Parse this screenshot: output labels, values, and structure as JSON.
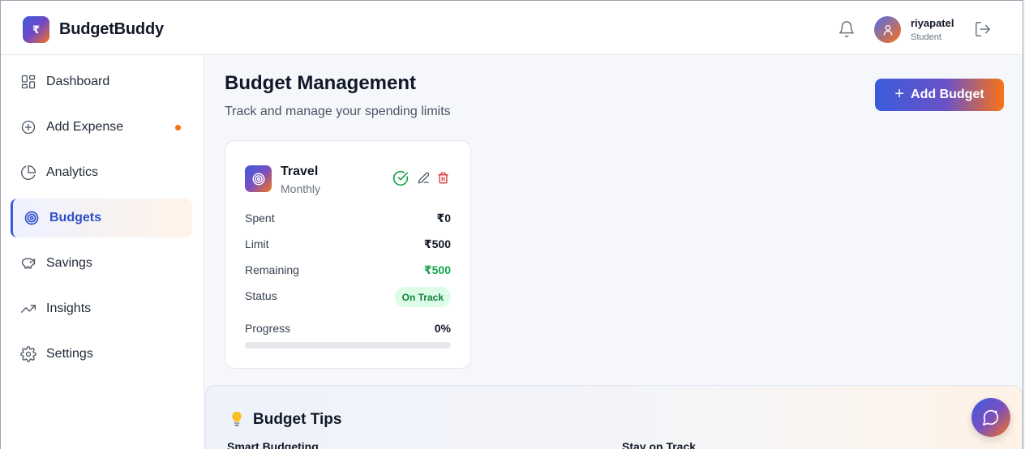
{
  "app": {
    "logo_symbol": "₹",
    "name": "BudgetBuddy"
  },
  "header": {
    "user_name": "riyapatel",
    "user_role": "Student",
    "icons": [
      "bell-icon",
      "user-icon",
      "logout-icon"
    ]
  },
  "sidebar": {
    "items": [
      {
        "label": "Dashboard",
        "icon": "dashboard-grid-icon",
        "active": false,
        "has_dot": false
      },
      {
        "label": "Add Expense",
        "icon": "plus-circle-icon",
        "active": false,
        "has_dot": true
      },
      {
        "label": "Analytics",
        "icon": "pie-chart-icon",
        "active": false,
        "has_dot": false
      },
      {
        "label": "Budgets",
        "icon": "target-icon",
        "active": true,
        "has_dot": false
      },
      {
        "label": "Savings",
        "icon": "piggy-bank-icon",
        "active": false,
        "has_dot": false
      },
      {
        "label": "Insights",
        "icon": "trending-up-icon",
        "active": false,
        "has_dot": false
      },
      {
        "label": "Settings",
        "icon": "gear-icon",
        "active": false,
        "has_dot": false
      }
    ]
  },
  "main": {
    "title": "Budget Management",
    "subtitle": "Track and manage your spending limits",
    "add_button_label": "Add Budget"
  },
  "budgets": [
    {
      "category": "Travel",
      "period": "Monthly",
      "spent_label": "Spent",
      "spent": "₹0",
      "limit_label": "Limit",
      "limit": "₹500",
      "remaining_label": "Remaining",
      "remaining": "₹500",
      "status_label": "Status",
      "status": "On Track",
      "progress_label": "Progress",
      "progress_text": "0%",
      "progress_fraction": 0
    }
  ],
  "tips": {
    "title": "Budget Tips",
    "items": [
      {
        "heading": "Smart Budgeting"
      },
      {
        "heading": "Stay on Track"
      }
    ]
  },
  "colors": {
    "primary": "#3b5bdb",
    "accent": "#f97316",
    "success": "#16a34a",
    "danger": "#dc2626"
  }
}
